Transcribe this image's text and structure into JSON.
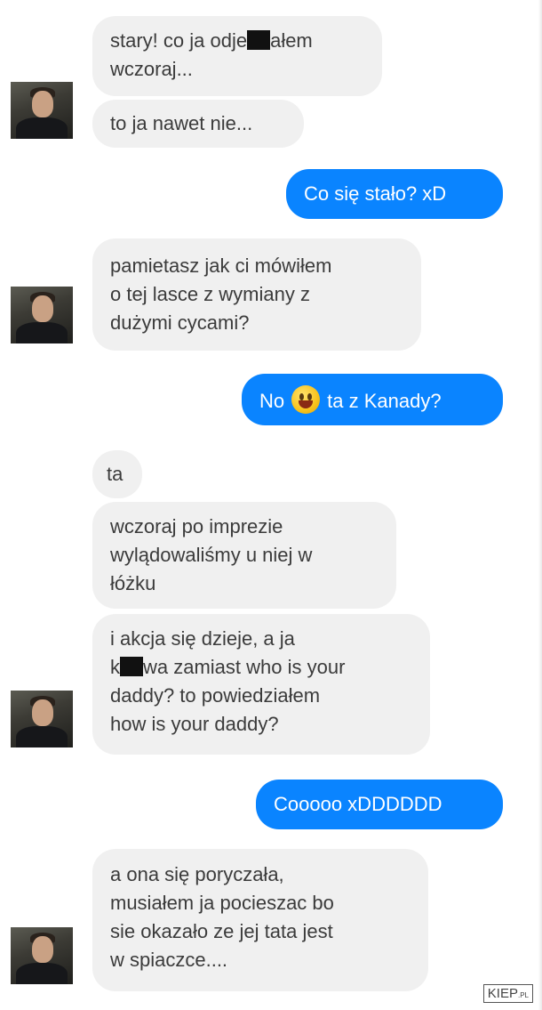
{
  "messages": [
    {
      "side": "in",
      "text_a": "stary! co ja odje",
      "text_b": "ałem\nwczoraj..."
    },
    {
      "side": "in",
      "text": "to ja nawet nie..."
    },
    {
      "side": "out",
      "text": "Co się stało? xD"
    },
    {
      "side": "in",
      "text": "pamietasz jak ci mówiłem\no tej lasce z wymiany z\ndużymi cycami?"
    },
    {
      "side": "out",
      "text_a": "No",
      "text_b": "ta z Kanady?",
      "emoji": "grinning-face"
    },
    {
      "side": "in",
      "text": "ta"
    },
    {
      "side": "in",
      "text": "wczoraj po imprezie\nwylądowaliśmy u niej w\nłóżku"
    },
    {
      "side": "in",
      "text_a": "i akcja się dzieje, a ja\nk",
      "text_b": "wa zamiast who is your\ndaddy? to powiedziałem\nhow is your daddy?"
    },
    {
      "side": "out",
      "text": "Cooooo xDDDDDD"
    },
    {
      "side": "in",
      "text": "a ona się poryczała,\nmusiałem ja pocieszac bo\nsie okazało ze jej tata jest\nw spiaczce...."
    }
  ],
  "colors": {
    "incoming": "#f0f0f0",
    "outgoing": "#0a84ff"
  },
  "watermark": {
    "text": "KIEP",
    "suffix": ".PL"
  }
}
